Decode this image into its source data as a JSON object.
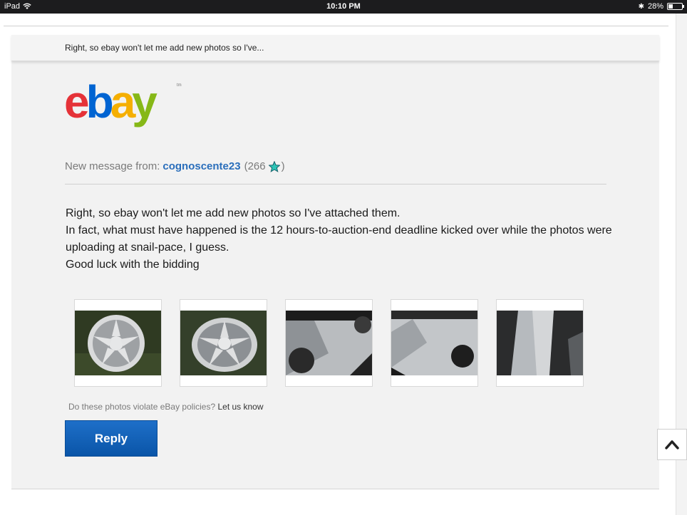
{
  "status_bar": {
    "device": "iPad",
    "time": "10:10 PM",
    "battery": "28%",
    "battery_level": 0.28
  },
  "preheader": {
    "text": "Right, so ebay won't let me add new photos so I've..."
  },
  "logo": {
    "text": "ebay",
    "letters": [
      "e",
      "b",
      "a",
      "y"
    ],
    "tm": "tm",
    "colors": [
      "#e53238",
      "#0064d2",
      "#f5af02",
      "#86b817"
    ]
  },
  "header": {
    "from_label": "New message from:",
    "username": "cognoscente23",
    "feedback_open": "(266",
    "feedback_close": ")",
    "star_icon": "turquoise-star-icon"
  },
  "message": {
    "lines": [
      "Right, so ebay won't let me add new photos so I've attached them.",
      "In fact, what must have happened is the 12 hours-to-auction-end deadline kicked over while the photos were uploading at snail-pace, I guess.",
      "Good luck with the bidding"
    ]
  },
  "photos": {
    "items": [
      "wheel-photo-1",
      "wheel-photo-2",
      "wheel-photo-3",
      "wheel-photo-4",
      "wheel-photo-5"
    ]
  },
  "policy": {
    "question": "Do these photos violate eBay policies?",
    "link": "Let us know"
  },
  "actions": {
    "reply_label": "Reply"
  },
  "scroll_to_top_icon": "chevron-up-icon",
  "colors": {
    "link_blue": "#2a6ebb",
    "reply_button": "#1566be"
  }
}
